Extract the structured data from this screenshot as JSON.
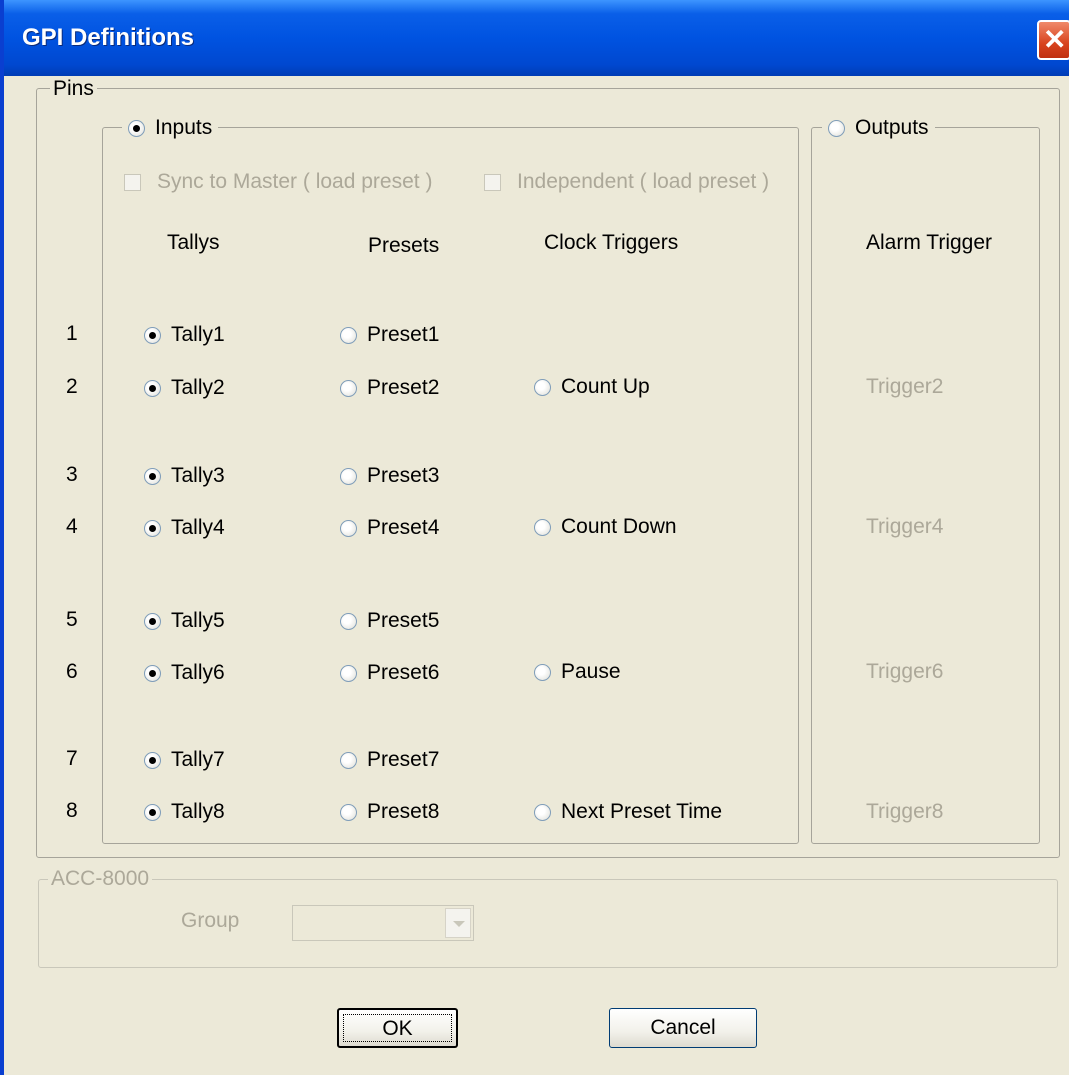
{
  "window": {
    "title": "GPI Definitions"
  },
  "pins": {
    "label": "Pins",
    "inputs_label": "Inputs",
    "outputs_label": "Outputs",
    "sync_to_master": "Sync to Master ( load preset )",
    "independent": "Independent ( load preset )",
    "headers": {
      "tallys": "Tallys",
      "presets": "Presets",
      "clock_triggers": "Clock Triggers",
      "alarm_trigger": "Alarm Trigger"
    },
    "rows": [
      {
        "num": "1",
        "tally": "Tally1",
        "preset": "Preset1",
        "clock": "",
        "alarm": ""
      },
      {
        "num": "2",
        "tally": "Tally2",
        "preset": "Preset2",
        "clock": "Count Up",
        "alarm": "Trigger2"
      },
      {
        "num": "3",
        "tally": "Tally3",
        "preset": "Preset3",
        "clock": "",
        "alarm": ""
      },
      {
        "num": "4",
        "tally": "Tally4",
        "preset": "Preset4",
        "clock": "Count Down",
        "alarm": "Trigger4"
      },
      {
        "num": "5",
        "tally": "Tally5",
        "preset": "Preset5",
        "clock": "",
        "alarm": ""
      },
      {
        "num": "6",
        "tally": "Tally6",
        "preset": "Preset6",
        "clock": "Pause",
        "alarm": "Trigger6"
      },
      {
        "num": "7",
        "tally": "Tally7",
        "preset": "Preset7",
        "clock": "",
        "alarm": ""
      },
      {
        "num": "8",
        "tally": "Tally8",
        "preset": "Preset8",
        "clock": "Next Preset Time",
        "alarm": "Trigger8"
      }
    ]
  },
  "acc": {
    "label": "ACC-8000",
    "group_label": "Group",
    "group_value": ""
  },
  "buttons": {
    "ok": "OK",
    "cancel": "Cancel"
  }
}
